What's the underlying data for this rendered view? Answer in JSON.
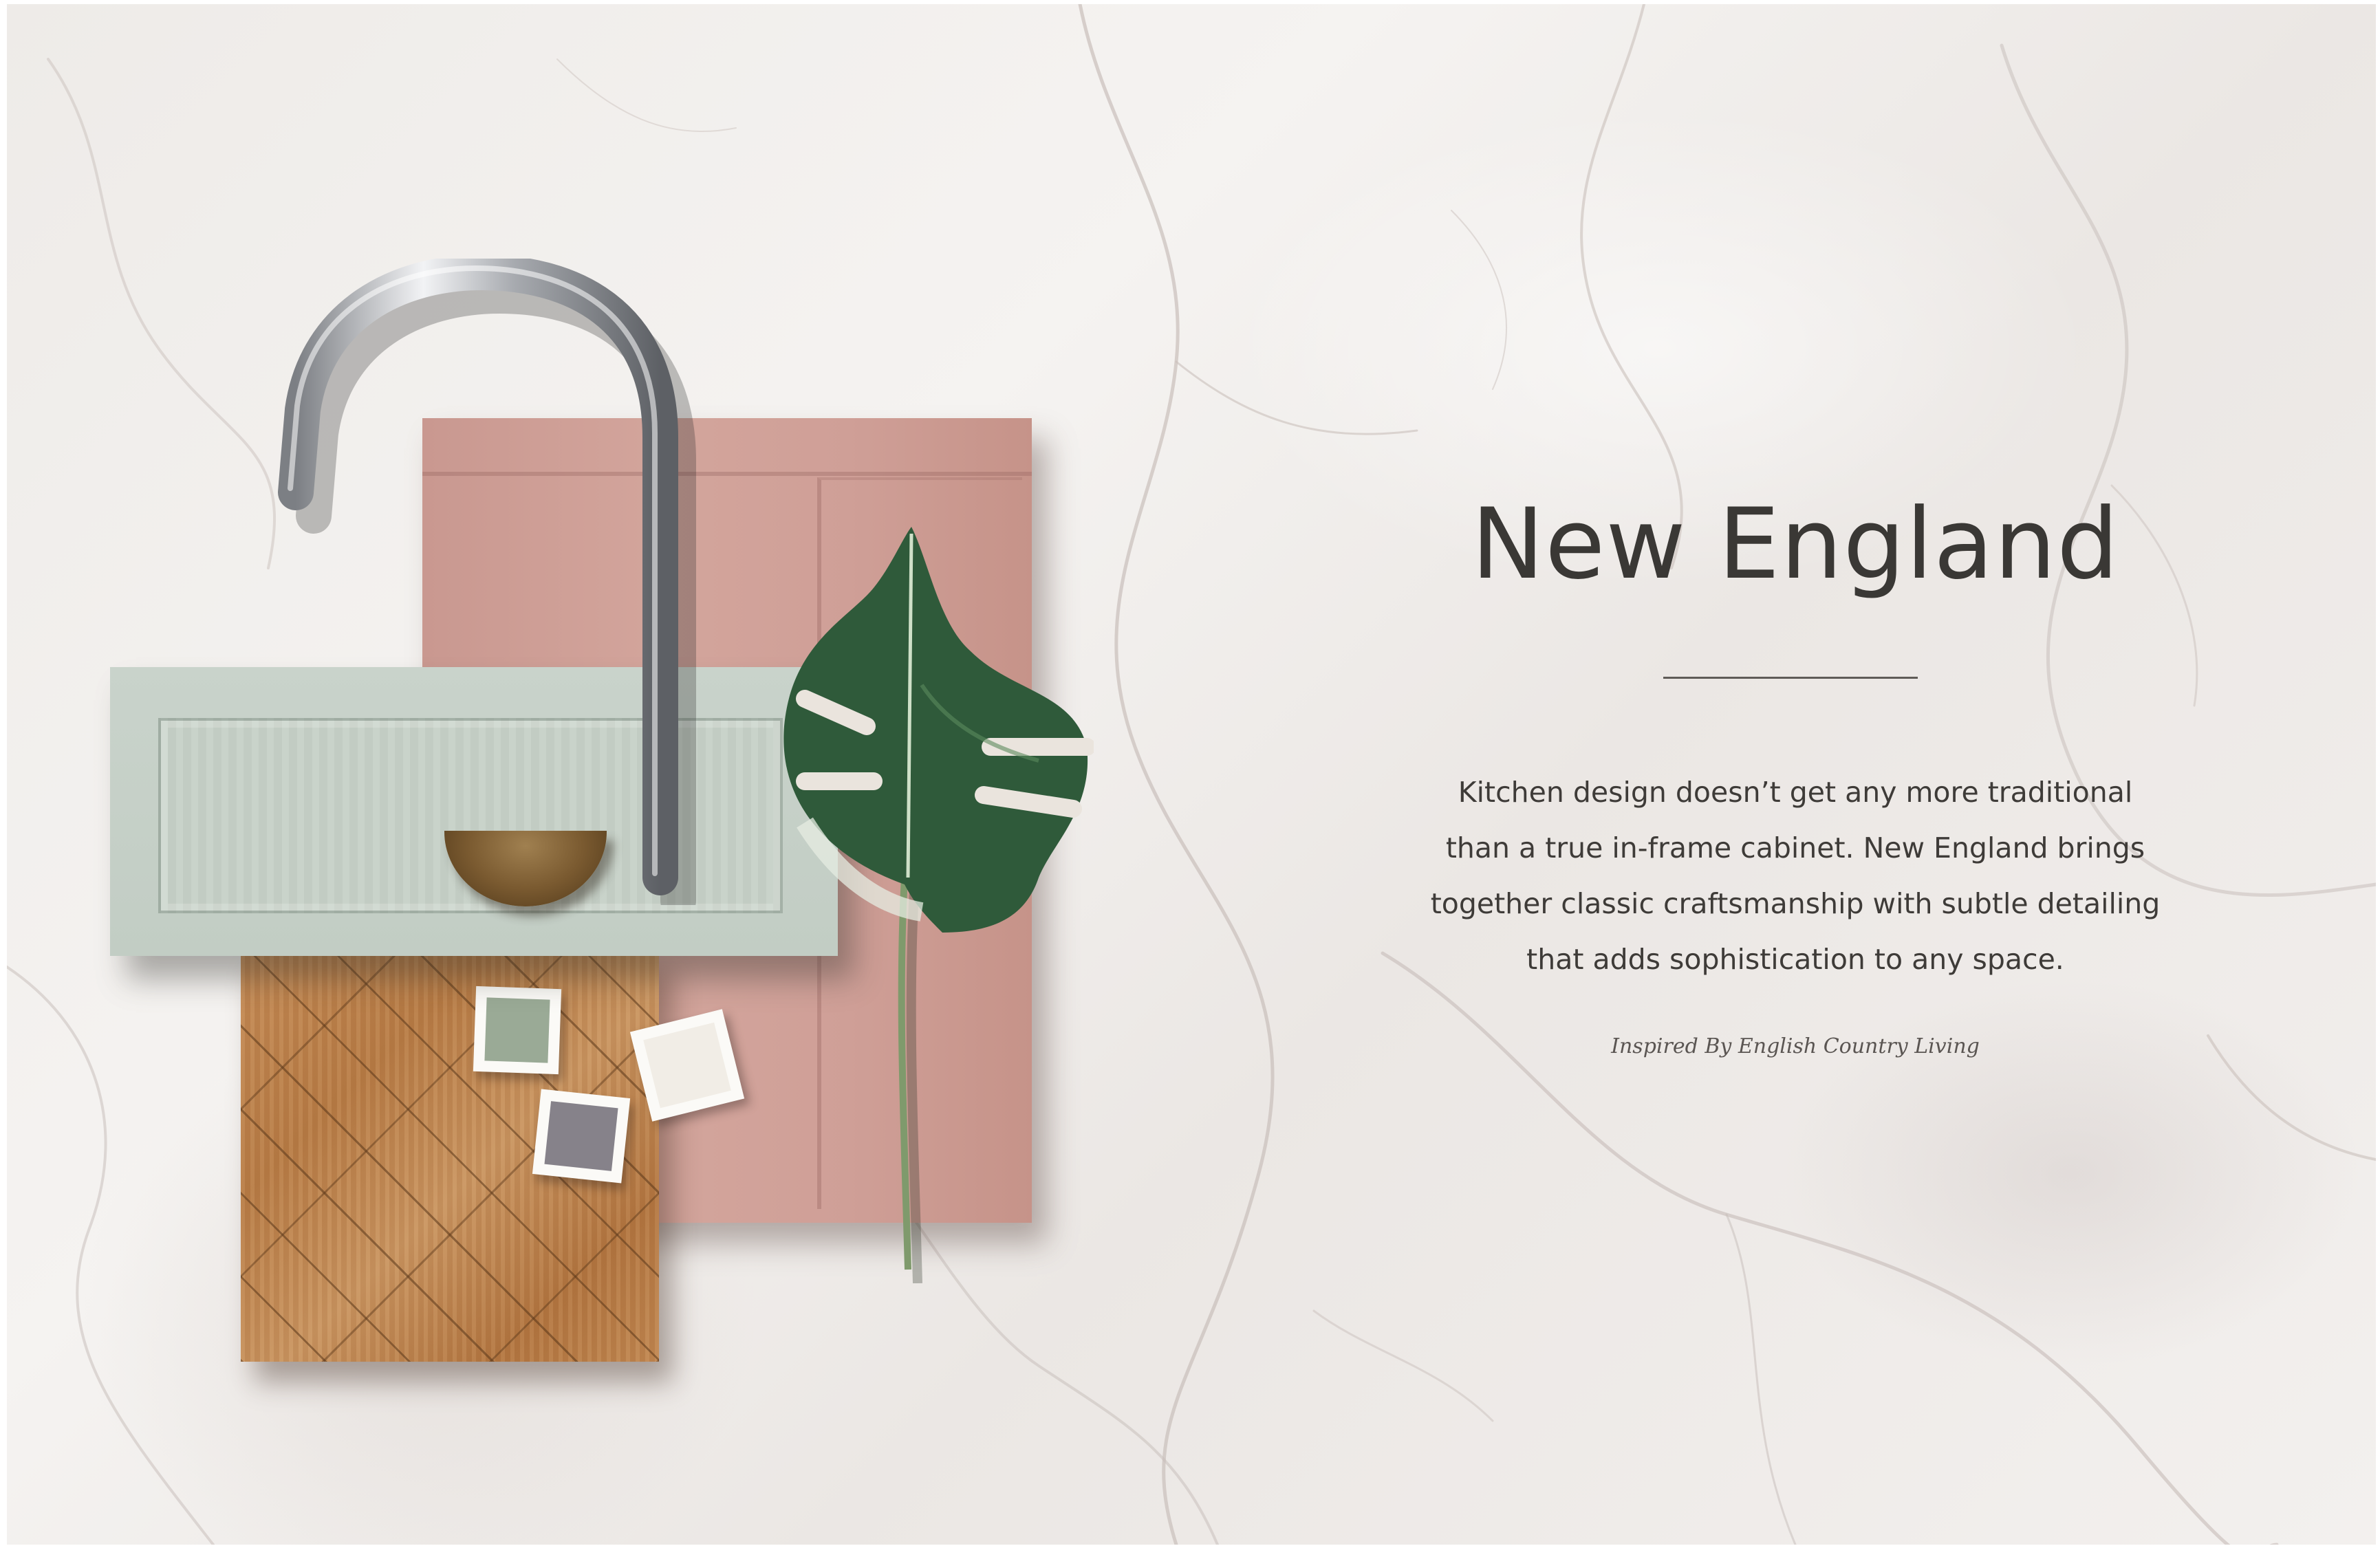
{
  "hero": {
    "title": "New England",
    "description_lines": [
      "Kitchen design doesn’t get any more traditional",
      "than a true in-frame cabinet. New England brings",
      "together classic craftsmanship with subtle detailing",
      "that adds sophistication to any space."
    ],
    "tagline": "Inspired By English Country Living"
  },
  "moodboard": {
    "items": [
      "tap-icon",
      "cabinet-door",
      "drawer-front",
      "cup-handle",
      "parquet-flooring",
      "paint-swatch",
      "monstera-leaf-icon"
    ]
  },
  "colors": {
    "text": "#3a3835",
    "pink_door": "#d0a199",
    "sage_drawer": "#c6d0c7",
    "marble": "#f0edea"
  }
}
